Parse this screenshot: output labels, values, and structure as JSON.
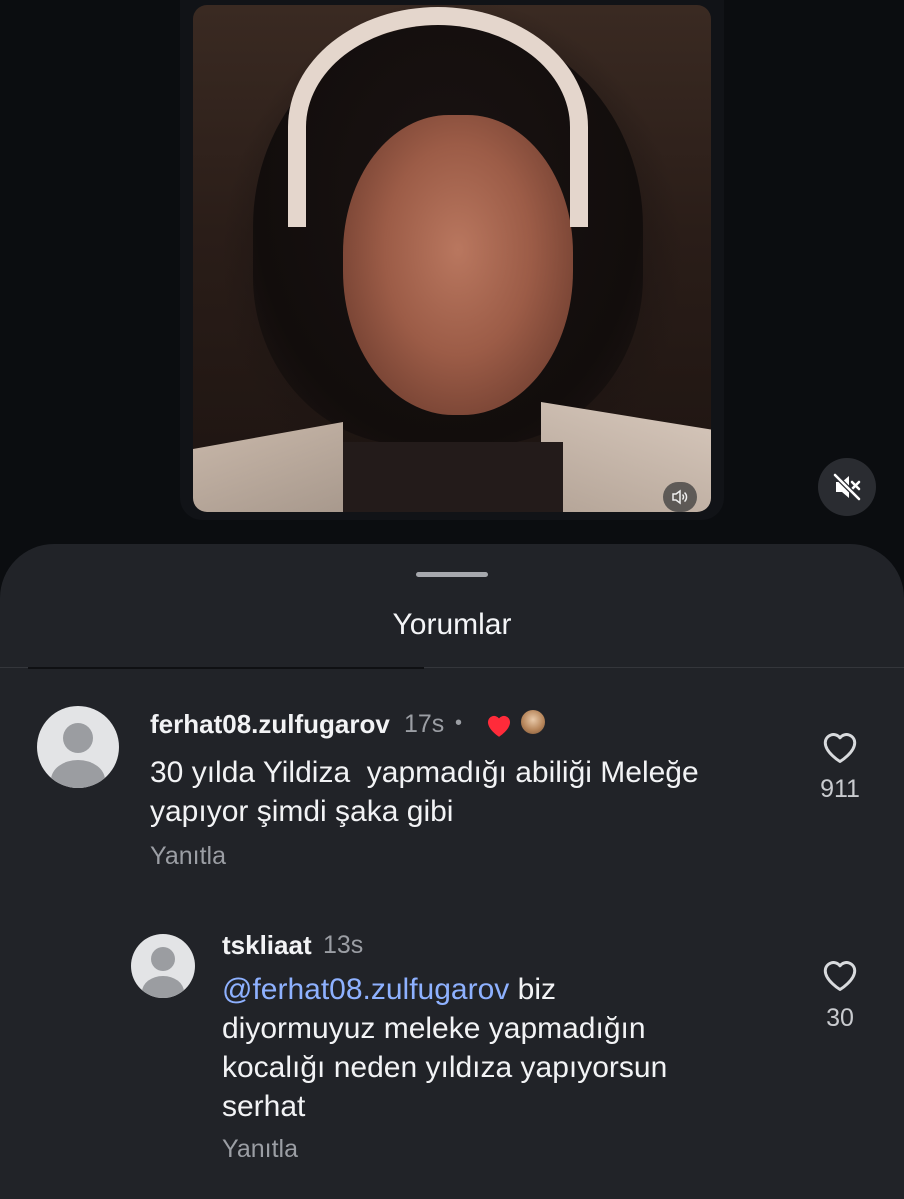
{
  "sheet": {
    "title": "Yorumlar"
  },
  "comments": [
    {
      "username": "ferhat08.zulfugarov",
      "time": "17s",
      "separator": "•",
      "text_line1": "30 yılda Yildiza  yapmadığı abiliği Meleğe",
      "text_line2": "yapıyor şimdi şaka gibi",
      "reply_label": "Yanıtla",
      "likes": "911",
      "icons": [
        "avatar-placeholder",
        "red-heart-icon",
        "creator-mini-avatar",
        "heart-outline-icon"
      ]
    },
    {
      "username": "tskliaat",
      "time": "13s",
      "mention": "@ferhat08.zulfugarov",
      "text_line1_rest": " biz",
      "text_line2": "diyormuyuz meleke yapmadığın",
      "text_line3": "kocalığı neden yıldıza yapıyorsun",
      "text_line4": "serhat",
      "reply_label": "Yanıtla",
      "likes": "30"
    }
  ],
  "video": {
    "icons": [
      "speaker-icon",
      "muted-speaker-icon"
    ]
  }
}
